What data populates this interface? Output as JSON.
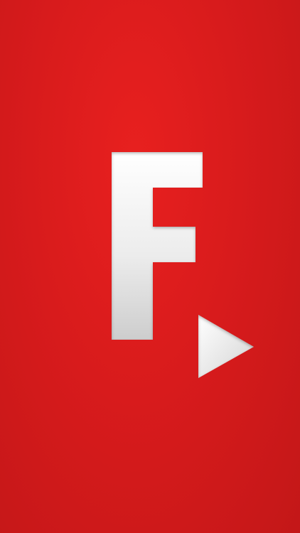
{
  "splash": {
    "background_color": "#dc1c1c",
    "logo": {
      "letter": "F",
      "icon": "play-icon",
      "fill_top": "#ffffff",
      "fill_bottom": "#cfcfcf"
    }
  }
}
